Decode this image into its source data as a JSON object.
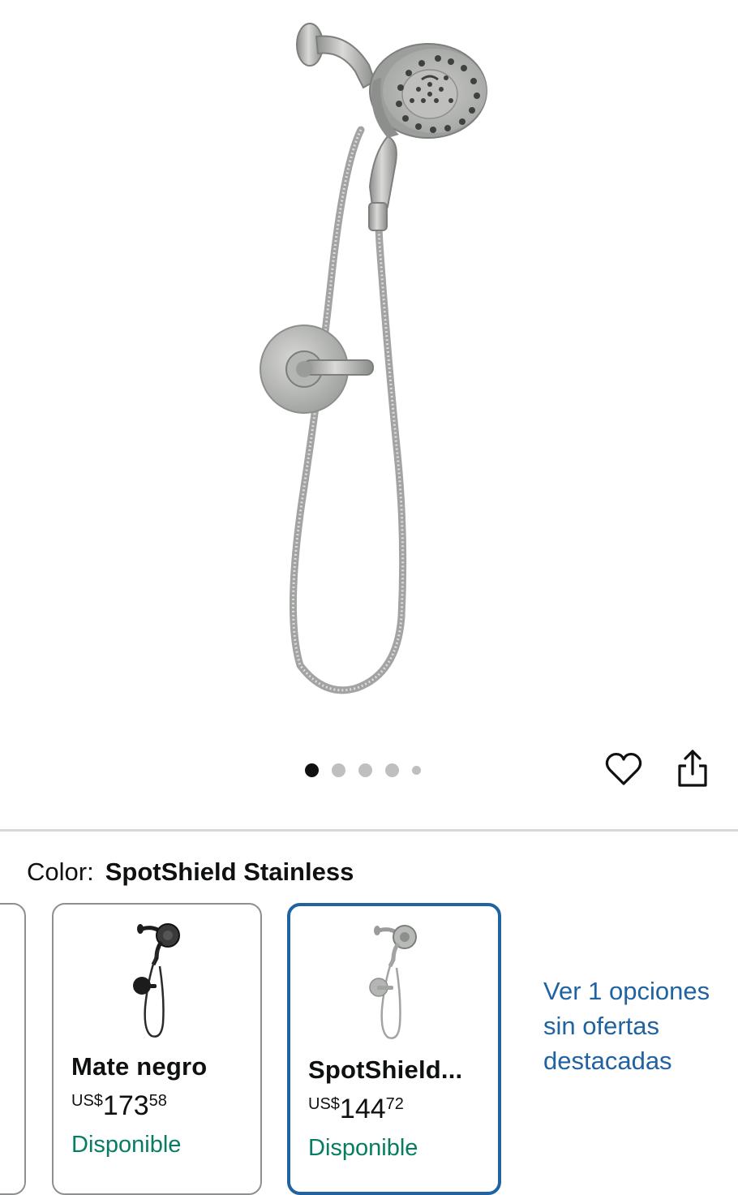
{
  "gallery": {
    "image_alt": "Regadera con ducha de mano",
    "slide_count": 5,
    "active_slide": 1
  },
  "actions": {
    "wishlist_icon": "heart-outline-icon",
    "share_icon": "share-icon"
  },
  "color_selector": {
    "label": "Color:",
    "selected_value": "SpotShield Stainless",
    "options": [
      {
        "name": "Mate negro",
        "price_currency": "US$",
        "price_whole": "173",
        "price_fraction": "58",
        "availability": "Disponible",
        "selected": false
      },
      {
        "name": "SpotShield...",
        "price_currency": "US$",
        "price_whole": "144",
        "price_fraction": "72",
        "availability": "Disponible",
        "selected": true
      }
    ],
    "more_options_link": "Ver 1 opciones sin ofertas destacadas"
  },
  "colors": {
    "selected_border": "#2162a1",
    "link": "#2162a1",
    "availability": "#067d62",
    "active_dot": "#0f1111",
    "inactive_dot": "#bfbfbf"
  }
}
